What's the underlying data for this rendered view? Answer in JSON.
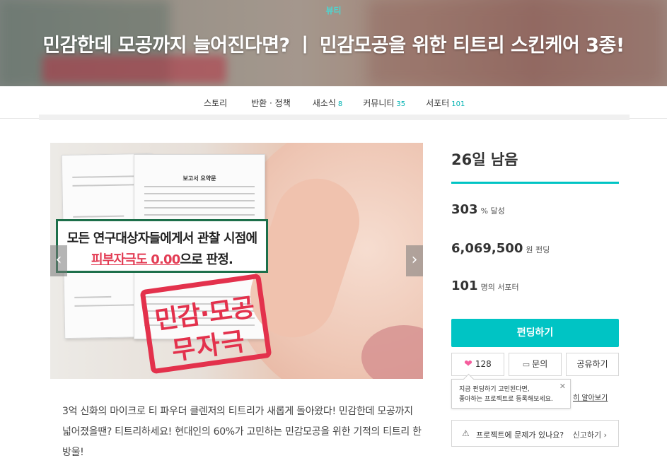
{
  "hero": {
    "category": "뷰티",
    "title": "민감한데 모공까지 늘어진다면? ㅣ 민감모공을 위한 티트리 스킨케어 3종!"
  },
  "nav": {
    "tabs": [
      {
        "label": "스토리",
        "count": ""
      },
      {
        "label": "반환 · 정책",
        "count": ""
      },
      {
        "label": "새소식",
        "count": "8"
      },
      {
        "label": "커뮤니티",
        "count": "35"
      },
      {
        "label": "서포터",
        "count": "101"
      }
    ]
  },
  "media": {
    "callout_line1": "모든 연구대상자들에게서 관찰 시점에",
    "callout_highlight": "피부자극도 0.00",
    "callout_line2_rest": "으로 판정.",
    "stamp_line1": "민감·모공",
    "stamp_line2": "무자극",
    "doc_title": "보고서 요약문"
  },
  "description": "3억 신화의 마이크로 티 파우더 클렌저의 티트리가 새롭게 돌아왔다! 민감한데 모공까지 넓어졌을땐? 티트리하세요! 현대인의 60%가 고민하는 민감모공을 위한 기적의 티트리 한 방울!",
  "panel": {
    "days_left": "26일 남음",
    "progress_fraction": 1.0,
    "achieved_value": "303",
    "achieved_unit": "% 달성",
    "amount_value": "6,069,500",
    "amount_unit": "원 펀딩",
    "supporters_value": "101",
    "supporters_unit": "명의 서포터",
    "fund_button": "펀딩하기",
    "like_count": "128",
    "inquiry_button": "문의",
    "share_button": "공유하기",
    "tooltip_line1": "지금 펀딩하기 고민된다면,",
    "tooltip_line2": "좋아하는 프로젝트로 등록해보세요.",
    "learn_more": "히 알아보기",
    "report_question": "프로젝트에 문제가 있나요?",
    "report_link": "신고하기 ›"
  },
  "colors": {
    "accent": "#00c4c4",
    "stamp_red": "#e3314c",
    "heart": "#f55d9d"
  },
  "icons": {
    "prev": "chevron-left-icon",
    "next": "chevron-right-icon",
    "heart": "heart-icon",
    "inquiry": "chat-icon",
    "report": "siren-icon",
    "close": "close-icon"
  }
}
